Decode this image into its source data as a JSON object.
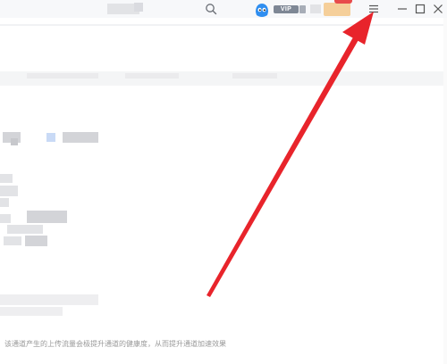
{
  "topbar": {
    "vip_label": "VIP",
    "icons": {
      "search": "search-icon",
      "menu": "hamburger-menu-icon",
      "minimize": "minimize-icon",
      "maximize": "maximize-icon",
      "close": "close-icon"
    }
  },
  "main": {
    "footer_tip": "该通道产生的上传流量会极提升通道的健康度，从而提升通道加速效果"
  },
  "annotation": {
    "arrow_color": "#e8242b"
  }
}
